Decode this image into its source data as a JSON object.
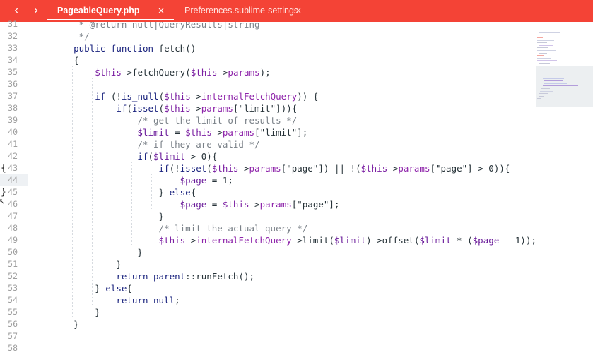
{
  "tabbar": {
    "back_icon": "chevron-left-icon",
    "forward_icon": "chevron-right-icon",
    "tabs": [
      {
        "label": "PageableQuery.php",
        "active": true,
        "close": "×"
      },
      {
        "label": "Preferences.sublime-settings",
        "active": false,
        "close": "×"
      }
    ],
    "accent_color": "#f44336"
  },
  "editor": {
    "current_line": 44,
    "lines": [
      {
        "n": "31",
        "code": "     * @return null|QueryResults|string"
      },
      {
        "n": "32",
        "code": "     */"
      },
      {
        "n": "33",
        "code": "    public function fetch()"
      },
      {
        "n": "34",
        "code": "    {"
      },
      {
        "n": "35",
        "code": "        $this->fetchQuery($this->params);"
      },
      {
        "n": "36",
        "code": ""
      },
      {
        "n": "37",
        "code": "        if (!is_null($this->internalFetchQuery)) {"
      },
      {
        "n": "38",
        "code": "            if(isset($this->params[\"limit\"])){"
      },
      {
        "n": "39",
        "code": "                /* get the limit of results */"
      },
      {
        "n": "40",
        "code": "                $limit = $this->params[\"limit\"];"
      },
      {
        "n": "41",
        "code": "                /* if they are valid */"
      },
      {
        "n": "42",
        "code": "                if($limit > 0){"
      },
      {
        "n": "43",
        "code": "                    if(!isset($this->params[\"page\"]) || !($this->params[\"page\"] > 0)){"
      },
      {
        "n": "44",
        "code": "                        $page = 1;"
      },
      {
        "n": "45",
        "code": "                    } else{"
      },
      {
        "n": "46",
        "code": "                        $page = $this->params[\"page\"];"
      },
      {
        "n": "47",
        "code": "                    }"
      },
      {
        "n": "48",
        "code": "                    /* limit the actual query */"
      },
      {
        "n": "49",
        "code": "                    $this->internalFetchQuery->limit($limit)->offset($limit * ($page - 1));"
      },
      {
        "n": "50",
        "code": "                }"
      },
      {
        "n": "51",
        "code": "            }"
      },
      {
        "n": "52",
        "code": "            return parent::runFetch();"
      },
      {
        "n": "53",
        "code": "        } else{"
      },
      {
        "n": "54",
        "code": "            return null;"
      },
      {
        "n": "55",
        "code": "        }"
      },
      {
        "n": "56",
        "code": "    }"
      },
      {
        "n": "57",
        "code": ""
      },
      {
        "n": "58",
        "code": ""
      }
    ],
    "fold_markers": [
      {
        "line": "43",
        "glyph": "{"
      },
      {
        "line": "45",
        "glyph": "}"
      }
    ]
  },
  "colors": {
    "keyword": "#1a237e",
    "variable": "#6a1b9a",
    "comment": "#7a8188",
    "text": "#263238",
    "line_number": "#9e9e9e"
  }
}
